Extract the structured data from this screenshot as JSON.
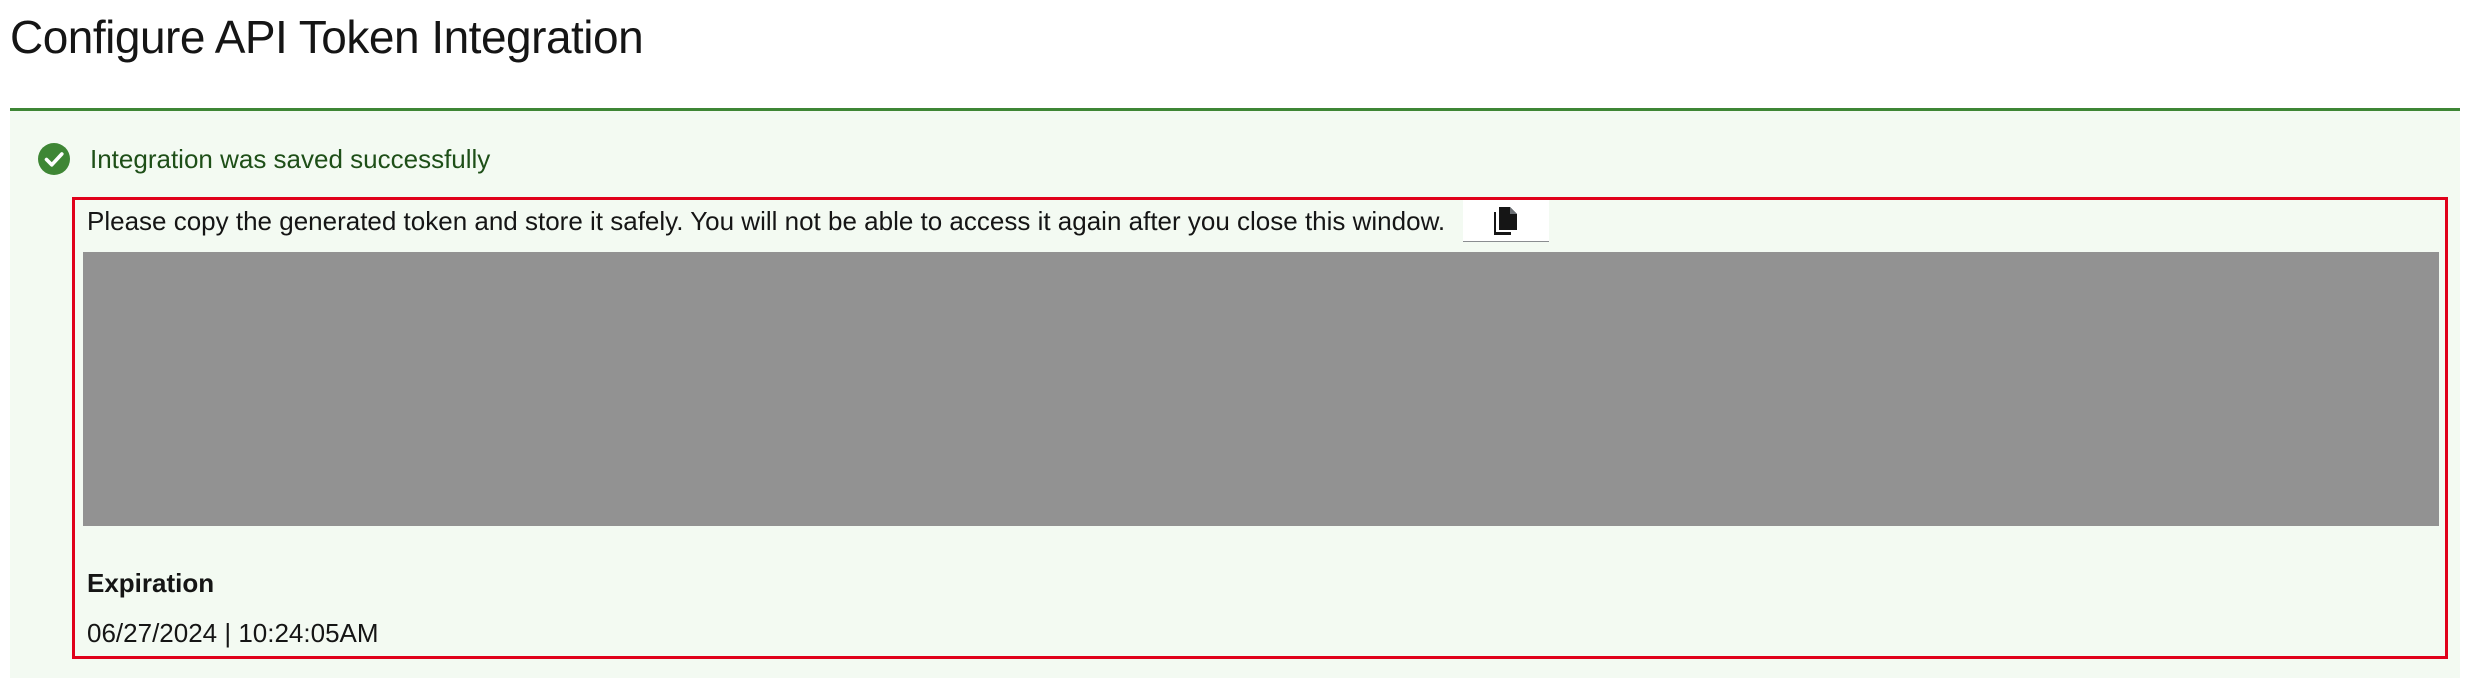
{
  "page": {
    "title": "Configure API Token Integration"
  },
  "alert": {
    "status": "success",
    "icon": "check-circle-icon",
    "title": "Integration was saved successfully",
    "colors": {
      "border": "#3e8635",
      "background": "#f3faf2",
      "title_text": "#1e4f18",
      "highlight_outline": "#e0001b"
    }
  },
  "token": {
    "message": "Please copy the generated token and store it safely. You will not be able to access it again after you close this window.",
    "copy_icon": "copy-icon",
    "redacted_color": "#929292"
  },
  "expiration": {
    "label": "Expiration",
    "value": "06/27/2024 | 10:24:05AM"
  }
}
